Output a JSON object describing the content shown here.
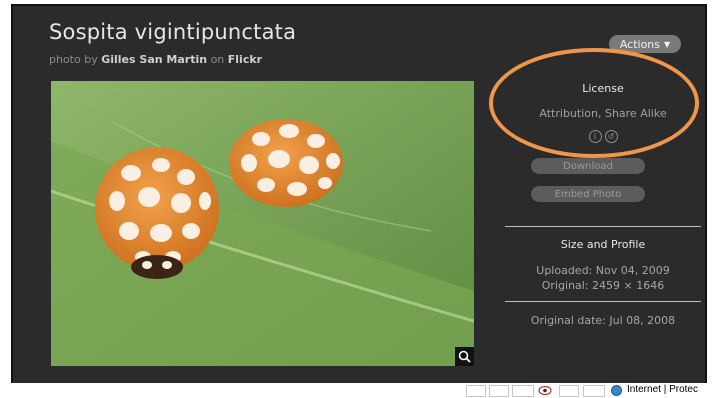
{
  "photo": {
    "title": "Sospita vigintipunctata",
    "byline_prefix": "photo by",
    "author": "Gilles San Martin",
    "byline_on": "on",
    "source": "Flickr",
    "alt": "Two orange ladybugs with white spots on a green leaf"
  },
  "actions": {
    "label": "Actions",
    "icon": "chevron-down-icon"
  },
  "license": {
    "title": "License",
    "text": "Attribution, Share Alike",
    "icons": [
      "cc-attribution-icon",
      "cc-share-alike-icon"
    ]
  },
  "buttons": {
    "download": "Download",
    "embed": "Embed Photo"
  },
  "size_profile": {
    "title": "Size and Profile",
    "uploaded_label": "Uploaded:",
    "uploaded_value": "Nov 04, 2009",
    "original_label": "Original:",
    "original_value": "2459 × 1646",
    "original_date_label": "Original date:",
    "original_date_value": "Jul 08, 2008"
  },
  "statusbar": {
    "zone": "Internet | Protec"
  },
  "colors": {
    "background": "#2b2b2b",
    "highlight_circle": "#f0964a",
    "accent_text": "#e8e8e8"
  }
}
